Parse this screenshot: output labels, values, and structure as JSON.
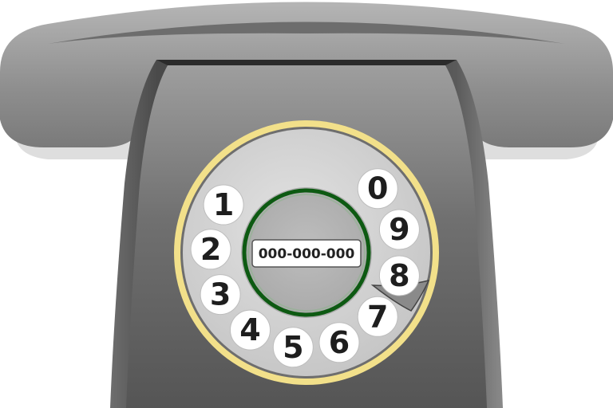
{
  "phone": {
    "number_card": "000-000-000",
    "dial_digits": [
      "1",
      "2",
      "3",
      "4",
      "5",
      "6",
      "7",
      "8",
      "9",
      "0"
    ]
  },
  "colors": {
    "body_dark": "#3a3a3a",
    "body_light": "#9a9a9a",
    "handset": "#8c8c8c",
    "dial_ring": "#f2e08a",
    "dial_face": "#d0d0d0",
    "center_ring": "#0d5a12"
  }
}
